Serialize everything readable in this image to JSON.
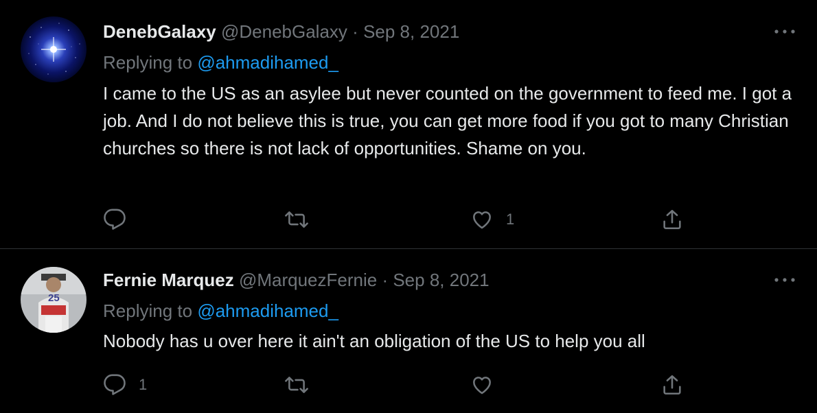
{
  "tweets": [
    {
      "display_name": "DenebGalaxy",
      "handle": "@DenebGalaxy",
      "separator": "·",
      "date": "Sep 8, 2021",
      "replying_label": "Replying to",
      "replying_to": "@ahmadihamed_",
      "text": "I came to the US as an asylee but never counted on the government to feed me. I got a job. And I do not believe this is true, you can get more food if you got to many Christian churches so there is not lack of opportunities. Shame on you.",
      "reply_count": "",
      "retweet_count": "",
      "like_count": "1"
    },
    {
      "display_name": "Fernie Marquez",
      "handle": "@MarquezFernie",
      "separator": "·",
      "date": "Sep 8, 2021",
      "replying_label": "Replying to",
      "replying_to": "@ahmadihamed_",
      "text": "Nobody has u over here it ain't an obligation of the US to help you all",
      "reply_count": "1",
      "retweet_count": "",
      "like_count": ""
    }
  ],
  "avatar_jersey_number": "25",
  "colors": {
    "background": "#000000",
    "text": "#e7e9ea",
    "muted": "#71767b",
    "link": "#1d9bf0",
    "divider": "#2f3336"
  },
  "icons": [
    "more-icon",
    "reply-icon",
    "retweet-icon",
    "like-icon",
    "share-icon"
  ]
}
